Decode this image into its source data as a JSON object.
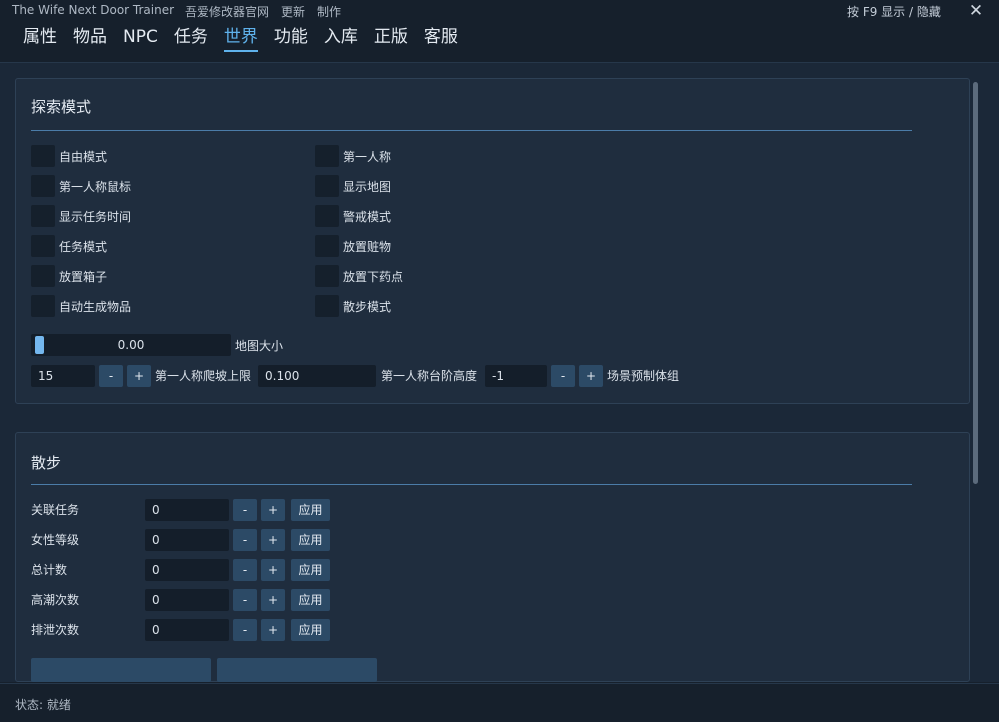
{
  "window": {
    "title": "The Wife Next Door Trainer",
    "links": [
      "吾爱修改器官网",
      "更新",
      "制作"
    ],
    "hotkey": "按 F9 显示 / 隐藏",
    "close": "✕"
  },
  "tabs": [
    {
      "label": "属性"
    },
    {
      "label": "物品"
    },
    {
      "label": "NPC"
    },
    {
      "label": "任务"
    },
    {
      "label": "世界"
    },
    {
      "label": "功能"
    },
    {
      "label": "入库"
    },
    {
      "label": "正版"
    },
    {
      "label": "客服"
    }
  ],
  "active_tab": "世界",
  "explore": {
    "title": "探索模式",
    "toggles_left": [
      {
        "label": "自由模式",
        "checked": false
      },
      {
        "label": "第一人称鼠标",
        "checked": false
      },
      {
        "label": "显示任务时间",
        "checked": false
      },
      {
        "label": "任务模式",
        "checked": false
      },
      {
        "label": "放置箱子",
        "checked": false
      },
      {
        "label": "自动生成物品",
        "checked": false
      }
    ],
    "toggles_right": [
      {
        "label": "第一人称",
        "checked": false
      },
      {
        "label": "显示地图",
        "checked": false
      },
      {
        "label": "警戒模式",
        "checked": false
      },
      {
        "label": "放置赃物",
        "checked": false
      },
      {
        "label": "放置下药点",
        "checked": false
      },
      {
        "label": "散步模式",
        "checked": false
      }
    ],
    "map_size": {
      "value": "0.00",
      "label": "地图大小",
      "fraction": 0.0
    },
    "slope": {
      "value": "15",
      "minus": "-",
      "plus": "+",
      "label": "第一人称爬坡上限"
    },
    "step": {
      "value": "0.100",
      "label": "第一人称台阶高度"
    },
    "prefab": {
      "value": "-1",
      "minus": "-",
      "plus": "+",
      "label": "场景预制体组"
    }
  },
  "walk": {
    "title": "散步",
    "rows": [
      {
        "label": "关联任务",
        "value": "0",
        "minus": "-",
        "plus": "+",
        "apply": "应用"
      },
      {
        "label": "女性等级",
        "value": "0",
        "minus": "-",
        "plus": "+",
        "apply": "应用"
      },
      {
        "label": "总计数",
        "value": "0",
        "minus": "-",
        "plus": "+",
        "apply": "应用"
      },
      {
        "label": "高潮次数",
        "value": "0",
        "minus": "-",
        "plus": "+",
        "apply": "应用"
      },
      {
        "label": "排泄次数",
        "value": "0",
        "minus": "-",
        "plus": "+",
        "apply": "应用"
      }
    ]
  },
  "status": "状态: 就绪",
  "colors": {
    "accent": "#5fb2ec",
    "background": "#1b2838",
    "button": "#2c4a66"
  }
}
